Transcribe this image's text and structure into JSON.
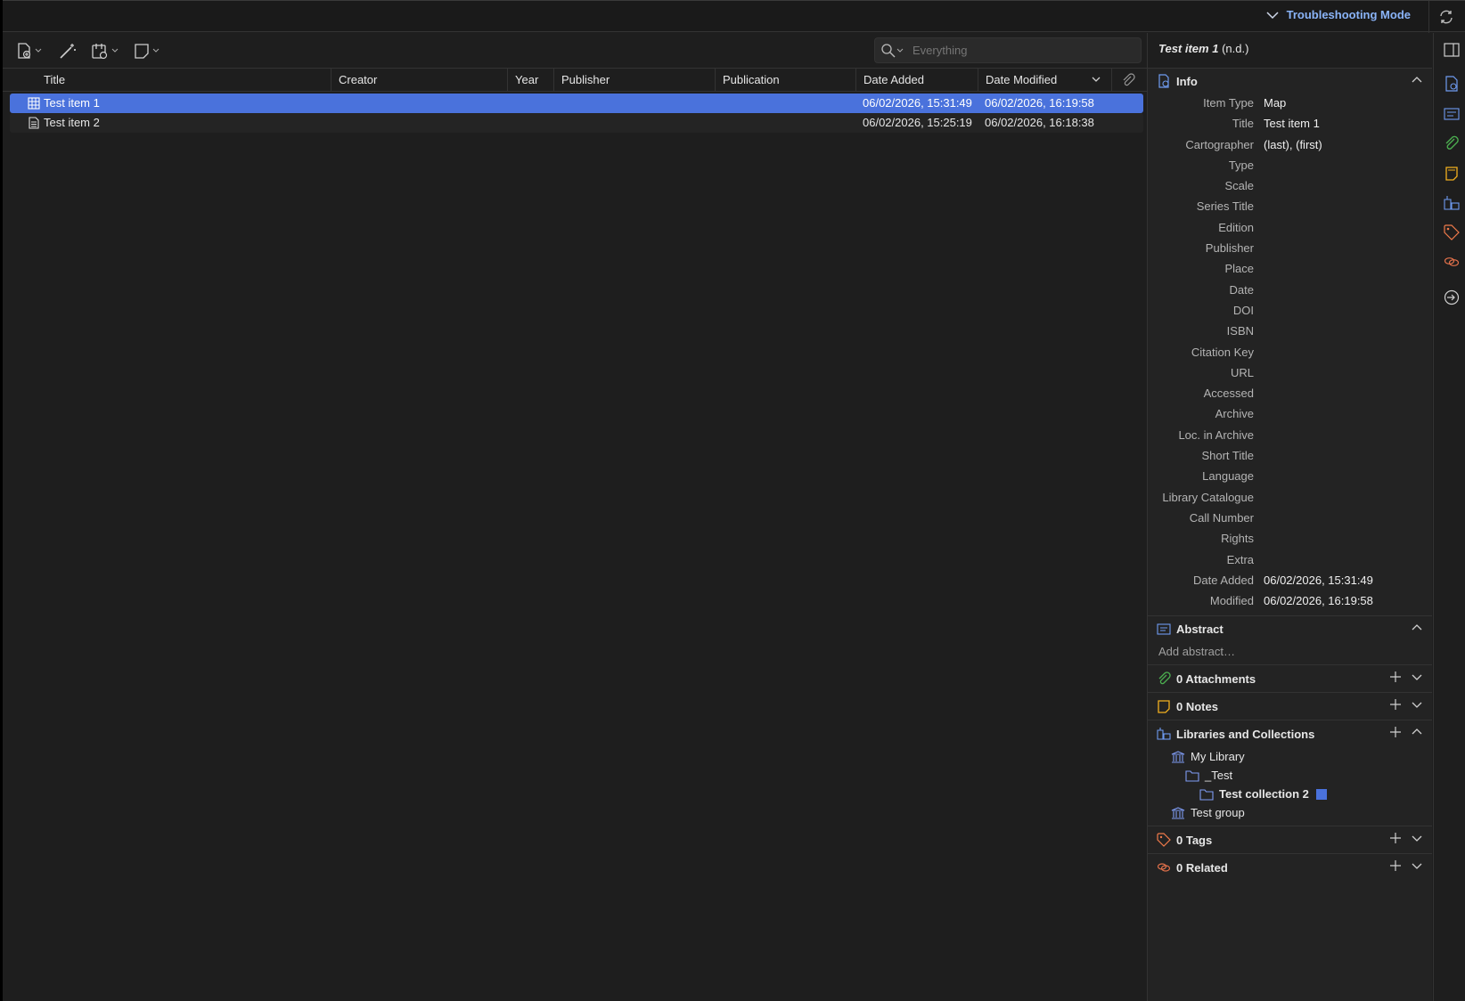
{
  "titlebar": {
    "mode_label": "Troubleshooting Mode"
  },
  "toolbar": {
    "search_placeholder": "Everything"
  },
  "columns": [
    "Title",
    "Creator",
    "Year",
    "Publisher",
    "Publication",
    "Date Added",
    "Date Modified"
  ],
  "items": [
    {
      "title": "Test item 1",
      "date_added": "06/02/2026, 15:31:49",
      "date_modified": "06/02/2026, 16:19:58",
      "icon": "map-icon"
    },
    {
      "title": "Test item 2",
      "date_added": "06/02/2026, 15:25:19",
      "date_modified": "06/02/2026, 16:18:38",
      "icon": "document-icon"
    }
  ],
  "pane": {
    "header_title": "Test item 1",
    "header_suffix": "(n.d.)",
    "info_label": "Info",
    "fields": [
      {
        "label": "Item Type",
        "value": "Map"
      },
      {
        "label": "Title",
        "value": "Test item 1"
      },
      {
        "label": "Cartographer",
        "value": "(last), (first)"
      },
      {
        "label": "Type",
        "value": ""
      },
      {
        "label": "Scale",
        "value": ""
      },
      {
        "label": "Series Title",
        "value": ""
      },
      {
        "label": "Edition",
        "value": ""
      },
      {
        "label": "Publisher",
        "value": ""
      },
      {
        "label": "Place",
        "value": ""
      },
      {
        "label": "Date",
        "value": ""
      },
      {
        "label": "DOI",
        "value": ""
      },
      {
        "label": "ISBN",
        "value": ""
      },
      {
        "label": "Citation Key",
        "value": ""
      },
      {
        "label": "URL",
        "value": ""
      },
      {
        "label": "Accessed",
        "value": ""
      },
      {
        "label": "Archive",
        "value": ""
      },
      {
        "label": "Loc. in Archive",
        "value": ""
      },
      {
        "label": "Short Title",
        "value": ""
      },
      {
        "label": "Language",
        "value": ""
      },
      {
        "label": "Library Catalogue",
        "value": ""
      },
      {
        "label": "Call Number",
        "value": ""
      },
      {
        "label": "Rights",
        "value": ""
      },
      {
        "label": "Extra",
        "value": ""
      },
      {
        "label": "Date Added",
        "value": "06/02/2026, 15:31:49"
      },
      {
        "label": "Modified",
        "value": "06/02/2026, 16:19:58"
      }
    ],
    "abstract_label": "Abstract",
    "abstract_placeholder": "Add abstract…",
    "attachments_label": "0 Attachments",
    "notes_label": "0 Notes",
    "libraries_label": "Libraries and Collections",
    "collections": [
      {
        "name": "My Library",
        "level": 0,
        "type": "library",
        "bold": false
      },
      {
        "name": "_Test",
        "level": 1,
        "type": "folder",
        "bold": false
      },
      {
        "name": "Test collection 2",
        "level": 2,
        "type": "folder",
        "bold": true
      },
      {
        "name": "Test group",
        "level": 0,
        "type": "library",
        "bold": false
      }
    ],
    "tags_label": "0 Tags",
    "related_label": "0 Related"
  },
  "colors": {
    "selection": "#4a72dc",
    "accent": "#8ab4f8",
    "attachments": "#4caf50",
    "notes": "#f2b01e",
    "tags": "#f07a4a",
    "related": "#e0704a"
  }
}
